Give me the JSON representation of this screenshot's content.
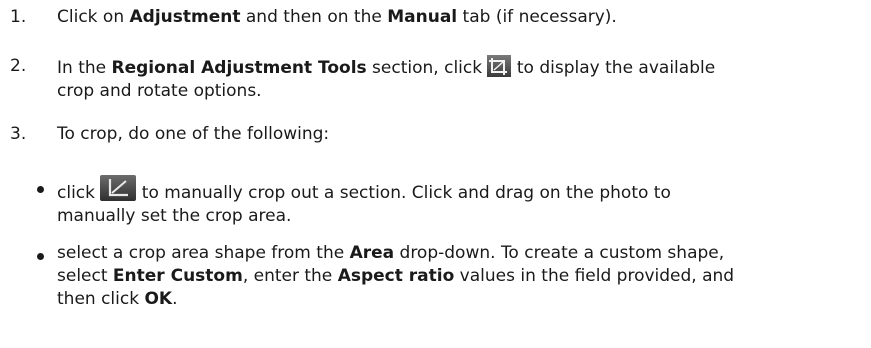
{
  "steps": [
    {
      "number": "1.",
      "parts": [
        "Click on ",
        "Adjustment",
        " and then on the ",
        "Manual",
        " tab (if necessary)."
      ]
    },
    {
      "number": "2.",
      "parts": [
        "In the ",
        "Regional Adjustment Tools",
        " section, click ",
        " to display the available",
        "crop and rotate options."
      ],
      "icon": "crop-rotate-icon"
    },
    {
      "number": "3.",
      "parts": [
        "To crop, do one of the following:"
      ]
    }
  ],
  "bullets": [
    {
      "parts": [
        "click ",
        " to manually crop out a section. Click and drag on the photo to",
        "manually set the crop area."
      ],
      "icon": "manual-crop-icon"
    },
    {
      "parts": [
        "select a crop area shape from the ",
        "Area",
        " drop-down. To create a custom shape,",
        "select ",
        "Enter Custom",
        ", enter the ",
        "Aspect ratio",
        " values in the field provided, and",
        "then click ",
        "OK",
        "."
      ]
    }
  ]
}
